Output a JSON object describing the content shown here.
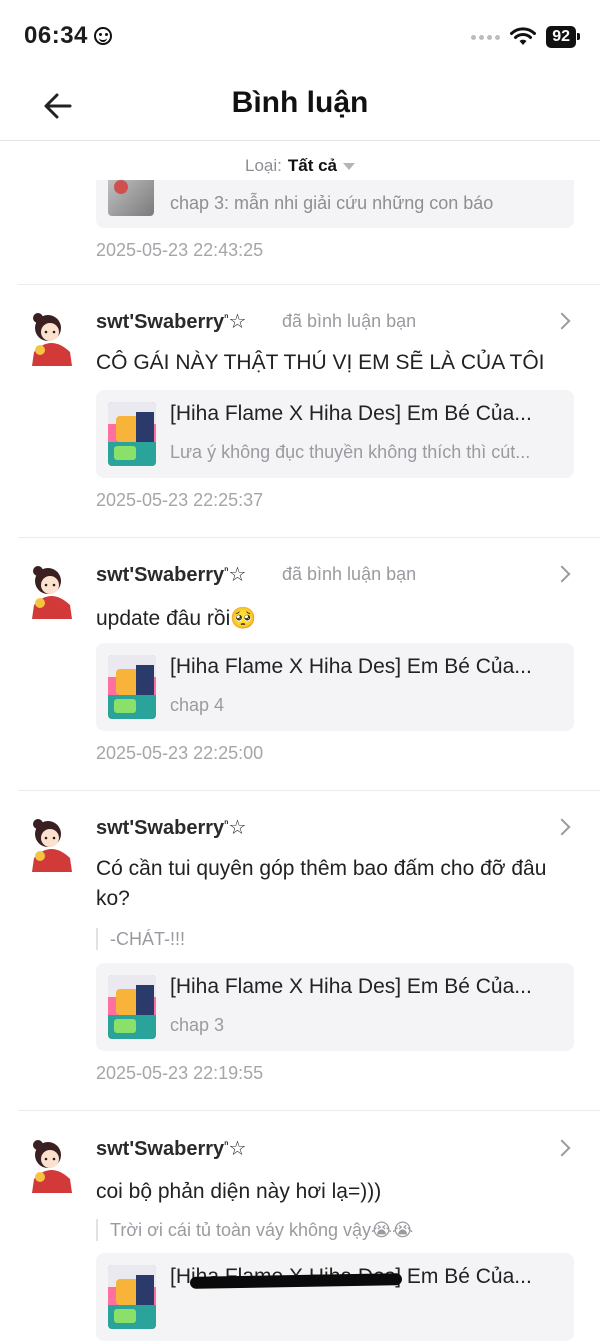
{
  "status_bar": {
    "time": "06:34",
    "battery": "92"
  },
  "header": {
    "title": "Bình luận"
  },
  "filter": {
    "label": "Loại:",
    "value": "Tất cả"
  },
  "partial_item": {
    "card_subtitle": "chap 3: mẫn nhi giải cứu những con báo",
    "timestamp": "2025-05-23 22:43:25"
  },
  "comments": [
    {
      "username": "swt'Swaberry",
      "username_sup": "ⁿ",
      "username_suffix": "☆",
      "action": "đã bình luận bạn",
      "text": "CÔ GÁI NÀY THẬT THÚ VỊ EM SẼ LÀ CỦA TÔI",
      "quote": "",
      "card_title": "[Hiha Flame X Hiha Des] Em Bé Của...",
      "card_subtitle": "Lưa ý không đục thuyền không thích thì cút...",
      "timestamp": "2025-05-23 22:25:37"
    },
    {
      "username": "swt'Swaberry",
      "username_sup": "ⁿ",
      "username_suffix": "☆",
      "action": "đã bình luận bạn",
      "text": "update đâu rồi🥺",
      "quote": "",
      "card_title": "[Hiha Flame X Hiha Des] Em Bé Của...",
      "card_subtitle": "chap 4",
      "timestamp": "2025-05-23 22:25:00"
    },
    {
      "username": "swt'Swaberry",
      "username_sup": "ⁿ",
      "username_suffix": "☆",
      "action": "",
      "text": "Có cần tui quyên góp thêm bao đấm cho đỡ đâu ko?",
      "quote": "-CHÁT-!!!",
      "card_title": "[Hiha Flame X Hiha Des] Em Bé Của...",
      "card_subtitle": "chap 3",
      "timestamp": "2025-05-23 22:19:55"
    },
    {
      "username": "swt'Swaberry",
      "username_sup": "ⁿ",
      "username_suffix": "☆",
      "action": "",
      "text": "coi bộ phản diện này hơi lạ=)))",
      "quote": "Trời ơi cái tủ toàn váy không vậy😭😭",
      "card_title": "[Hiha Flame X Hiha Des] Em Bé Của...",
      "card_subtitle": "",
      "timestamp": ""
    }
  ],
  "icons": {
    "back": "arrow-left-icon",
    "chevron": "chevron-right-icon",
    "filter_caret": "caret-down-icon"
  },
  "colors": {
    "text_primary": "#1c1c1e",
    "text_secondary": "#9a9aa0",
    "card_bg": "#f4f4f6",
    "divider": "#ececec"
  }
}
